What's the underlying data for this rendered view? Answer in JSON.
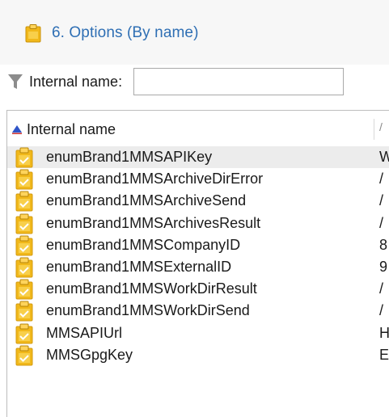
{
  "header": {
    "title": "6. Options (By name)",
    "title_color": "#2f6fb4"
  },
  "filter": {
    "label": "Internal name:",
    "value": "",
    "placeholder": ""
  },
  "list": {
    "column_name": "Internal name",
    "column_value": "/",
    "sort_direction": "ascending",
    "rows": [
      {
        "name": "enumBrand1MMSAPIKey",
        "value": "W",
        "selected": true
      },
      {
        "name": "enumBrand1MMSArchiveDirError",
        "value": "/",
        "selected": false
      },
      {
        "name": "enumBrand1MMSArchiveSend",
        "value": "/",
        "selected": false
      },
      {
        "name": "enumBrand1MMSArchivesResult",
        "value": "/",
        "selected": false
      },
      {
        "name": "enumBrand1MMSCompanyID",
        "value": "8",
        "selected": false
      },
      {
        "name": "enumBrand1MMSExternalID",
        "value": "9",
        "selected": false
      },
      {
        "name": "enumBrand1MMSWorkDirResult",
        "value": "/",
        "selected": false
      },
      {
        "name": "enumBrand1MMSWorkDirSend",
        "value": "/",
        "selected": false
      },
      {
        "name": "MMSAPIUrl",
        "value": "H",
        "selected": false
      },
      {
        "name": "MMSGpgKey",
        "value": "E",
        "selected": false
      }
    ]
  },
  "icons": {
    "title": "clipboard-icon",
    "filter": "funnel-icon",
    "sort": "sort-ascending-icon",
    "row": "option-clipboard-icon"
  }
}
